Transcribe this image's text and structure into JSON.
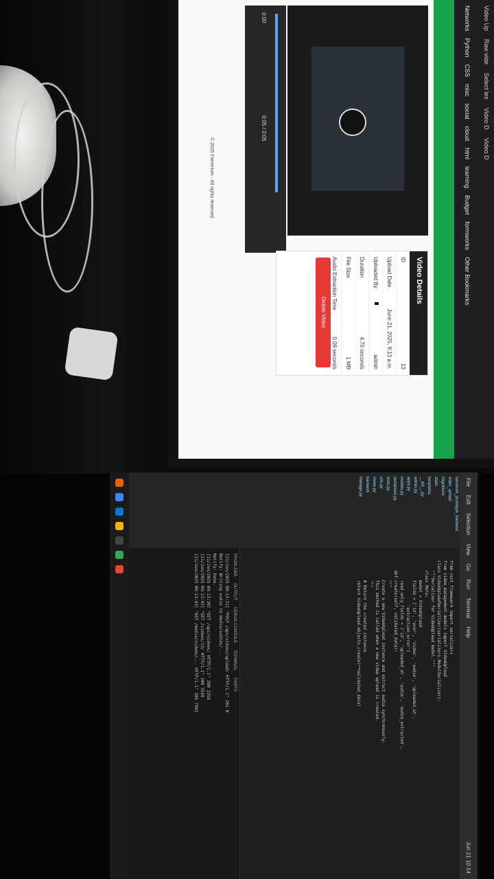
{
  "browser": {
    "tabs": [
      "Video Up",
      "Raw vide",
      "Select les",
      "Video D",
      "Video D"
    ],
    "bookmarks": [
      "Networks",
      "Python",
      "CSS",
      "misc",
      "social",
      "cloud",
      "html",
      "learning",
      "Budget",
      "formworks",
      "Other Bookmarks"
    ],
    "video": {
      "current_time": "0:00",
      "duration_display": "0:05 / 0:05",
      "progress": 1.0
    },
    "details": {
      "title": "Video Details",
      "rows": [
        {
          "label": "ID",
          "value": "13"
        },
        {
          "label": "Upload Date",
          "value": "June 21, 2025, 9:13 a.m."
        },
        {
          "label": "Uploaded By",
          "value": "admin"
        },
        {
          "label": "Duration",
          "value": "4.70 seconds"
        },
        {
          "label": "File Size",
          "value": "1 MB"
        },
        {
          "label": "Audio Extraction Time",
          "value": "0.09 seconds"
        }
      ],
      "delete_label": "Delete Video"
    },
    "footer": "© 2025 FarmHum - All rights reserved"
  },
  "vscode": {
    "menu": [
      "File",
      "Edit",
      "Selection",
      "View",
      "Go",
      "Run",
      "Terminal",
      "Help"
    ],
    "clock": "Jun 21 10:14",
    "sidebar_items": [
      "farmwork_prototype_backend",
      "video_upload",
      "migrations",
      "static",
      "templates",
      "__init__.py",
      "admin.py",
      "apps.py",
      "models.py",
      "serializers.py",
      "tests.py",
      "urls.py",
      "views.py",
      "backend",
      "manage.py"
    ],
    "code_lines": [
      "from rest_framework import serializers",
      "from video_management.models import VideoUpload",
      "",
      "class VideoUploadSerializer(serializers.ModelSerializer):",
      "    \"\"\"Serializer for VideoUpload model.\"\"\"",
      "    class Meta:",
      "        model = VideoUpload",
      "        fields = ['id', 'user', 'video', 'audio', 'uploaded_at',",
      "                  'extraction_error']",
      "        read_only_fields = ['id', 'uploaded_at', 'audio', 'audio_extracted',",
      "",
      "    def create(self, validated_data):",
      "        \"\"\"",
      "        Create a new VideoUpload instance and extract audio synchronously.",
      "        This method is called when a new video upload is created.",
      "        \"\"\"",
      "        # Return the created instance",
      "        return VideoUpload.objects.create(**validated_data)"
    ],
    "terminal_tabs": [
      "PROBLEMS",
      "OUTPUT",
      "DEBUG CONSOLE",
      "TERMINAL",
      "PORTS"
    ],
    "terminal_lines": [
      "[21/Jun/2025 09:13:31] \"POST /api/videos/upload/ HTTP/1.1\" 201 0",
      "Notify: Writing audio to media/audios/...",
      "Notify: Done.",
      "[21/Jun/2025 09:13:38] \"GET /api/videos/ HTTP/1.1\" 200 2358",
      "[21/Jun/2025 09:13:43] \"GET /videos/13/ HTTP/1.1\" 200 3559",
      "[21/Jun/2025 09:13:43] \"GET /media/videos/... HTTP/1.1\" 206 7993"
    ]
  }
}
